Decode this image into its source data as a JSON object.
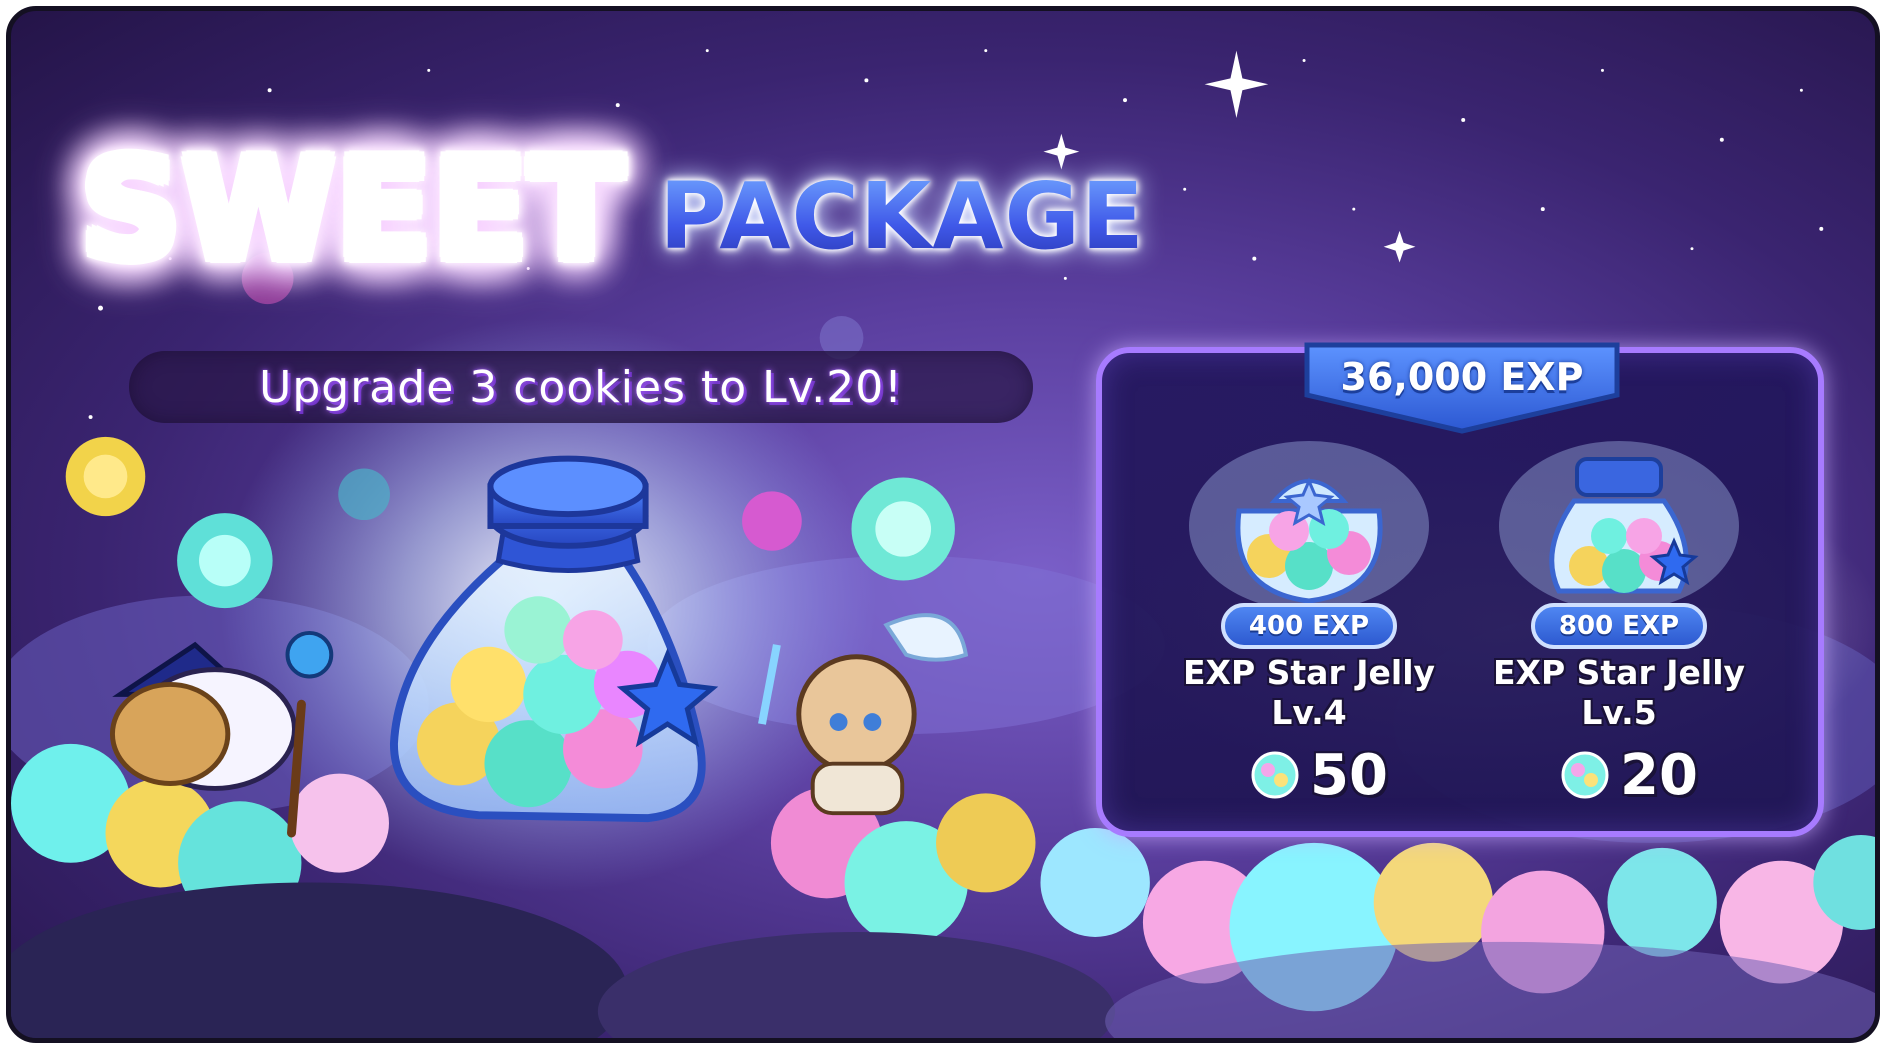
{
  "banner": {
    "title_main": "SWEET",
    "title_secondary": "PACKAGE",
    "subtitle": "Upgrade 3 cookies to Lv.20!"
  },
  "package": {
    "total_label": "36,000 EXP",
    "items": [
      {
        "exp_label": "400 EXP",
        "name_line1": "EXP Star Jelly",
        "name_line2": "Lv.4",
        "quantity": "50",
        "icon": "star-jelly-bag-icon"
      },
      {
        "exp_label": "800 EXP",
        "name_line1": "EXP Star Jelly",
        "name_line2": "Lv.5",
        "quantity": "20",
        "icon": "star-jelly-jar-icon"
      }
    ]
  },
  "colors": {
    "frame_border": "#141022",
    "panel_border": "#a77bff",
    "banner_blue": "#3f6fe0",
    "title_pink": "#d457c9",
    "title_blue": "#3f58e8"
  }
}
